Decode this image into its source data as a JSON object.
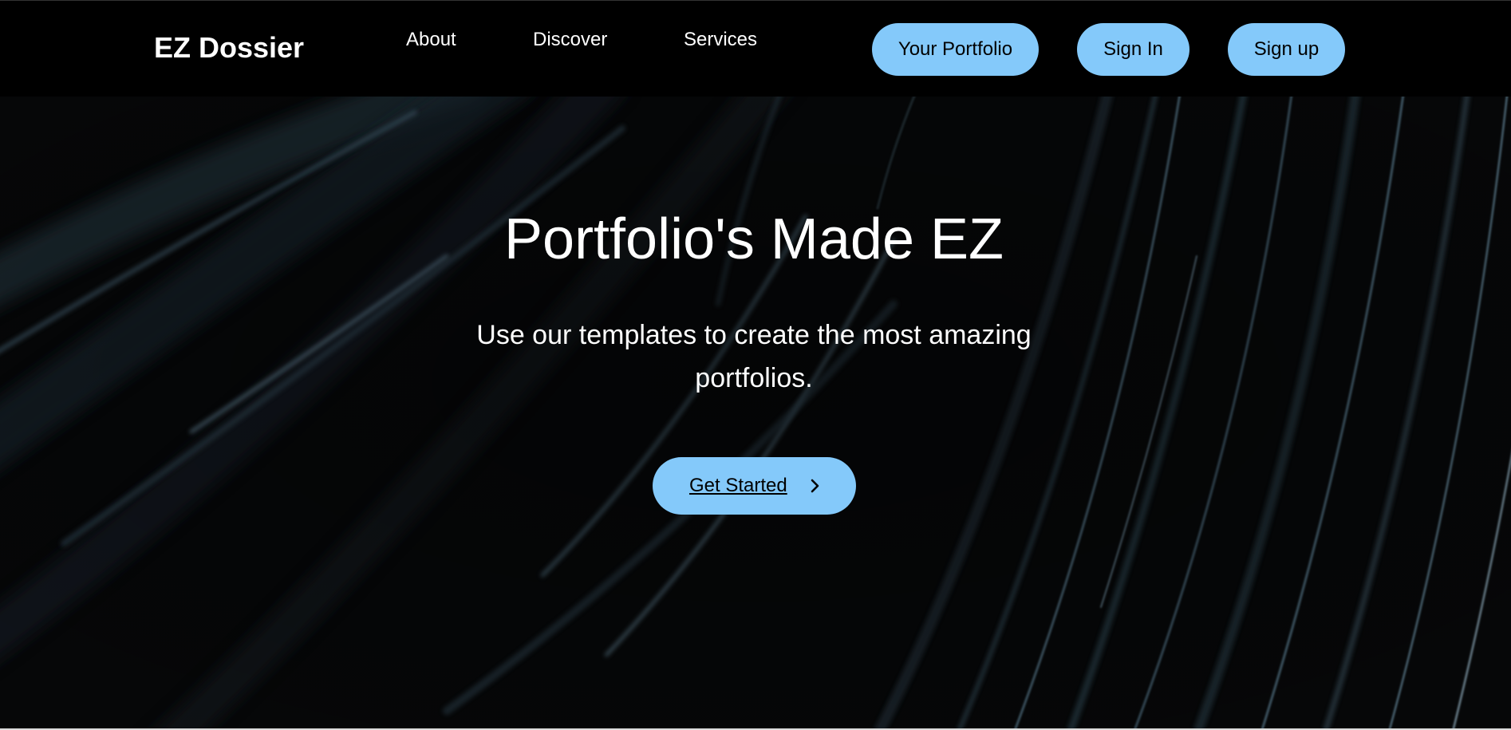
{
  "nav": {
    "brand": "EZ Dossier",
    "links": [
      "About",
      "Discover",
      "Services"
    ],
    "buttons": {
      "portfolio": "Your Portfolio",
      "sign_in": "Sign In",
      "sign_up": "Sign up"
    }
  },
  "hero": {
    "title": "Portfolio's Made EZ",
    "subtitle": "Use our templates to create the most amazing portfolios.",
    "cta_label": "Get Started",
    "cta_icon": "chevron-right-icon"
  },
  "colors": {
    "accent": "#84c9fa",
    "background": "#000000",
    "text": "#ffffff"
  }
}
